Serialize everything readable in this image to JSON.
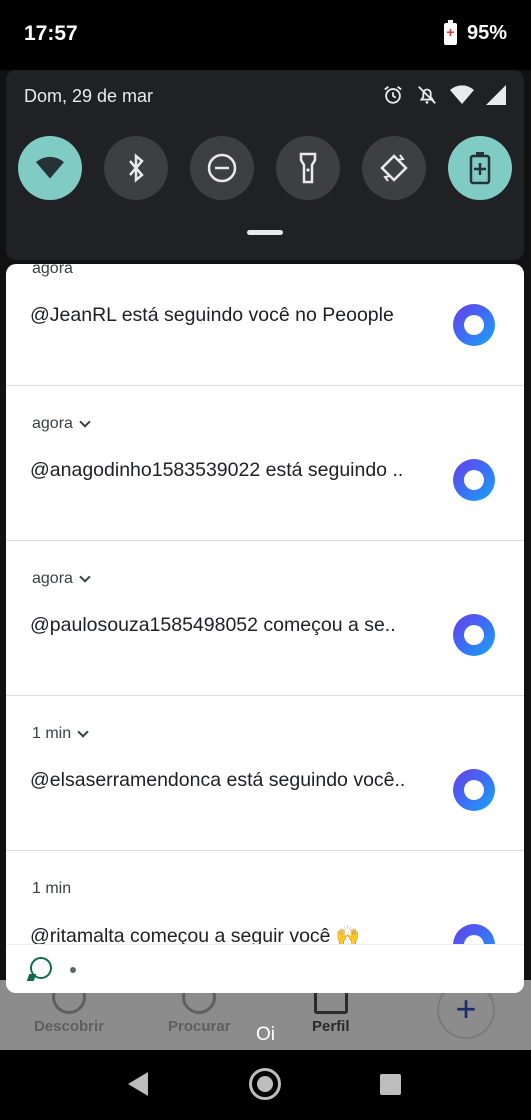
{
  "status_bar": {
    "time": "17:57",
    "battery": "95%"
  },
  "quick_settings": {
    "date": "Dom, 29 de mar",
    "indicators": [
      "alarm-icon",
      "bell-off-icon",
      "wifi-icon",
      "signal-icon"
    ],
    "tiles": [
      {
        "icon": "wifi-icon",
        "active": true
      },
      {
        "icon": "bluetooth-icon",
        "active": false
      },
      {
        "icon": "do-not-disturb-icon",
        "active": false
      },
      {
        "icon": "flashlight-icon",
        "active": false
      },
      {
        "icon": "auto-rotate-icon",
        "active": false
      },
      {
        "icon": "battery-saver-icon",
        "active": true
      }
    ],
    "active_color": "#80cbc4"
  },
  "notifications": [
    {
      "time": "agora",
      "expandable": false,
      "text": "@JeanRL está seguindo você no Peoople"
    },
    {
      "time": "agora",
      "expandable": true,
      "text": "@anagodinho1583539022 está seguindo .."
    },
    {
      "time": "agora",
      "expandable": true,
      "text": "@paulosouza1585498052 começou a se.."
    },
    {
      "time": "1 min",
      "expandable": true,
      "text": "@elsaserramendonca está seguindo você.."
    },
    {
      "time": "1 min",
      "expandable": false,
      "text": "@ritamalta começou a seguir você 🙌"
    }
  ],
  "background_app": {
    "nav": [
      "Descobrir",
      "Procurar",
      "Perfil"
    ],
    "plus": "+"
  },
  "toast": "Oi",
  "nav_bar": {
    "back": "back-icon",
    "home": "home-icon",
    "recents": "recents-icon"
  }
}
